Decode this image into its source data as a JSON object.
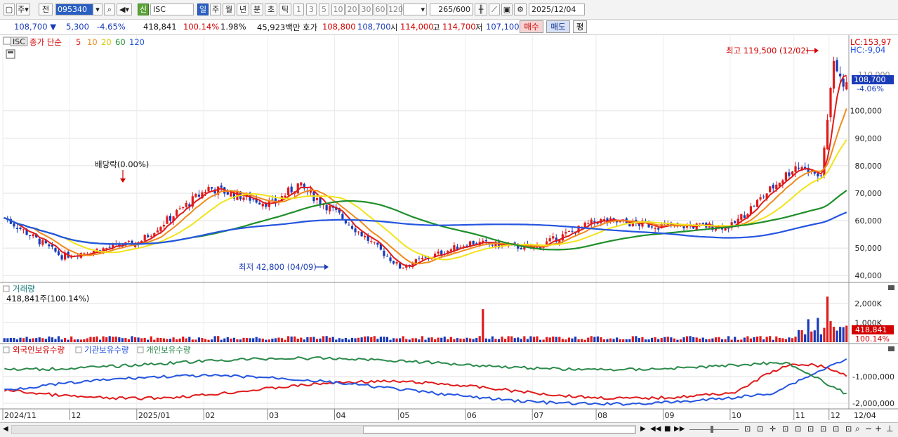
{
  "toolbar": {
    "period_select": "주",
    "prev_label": "전",
    "code": "095340",
    "new_badge": "신",
    "name": "ISC",
    "periods": [
      "일",
      "주",
      "월",
      "년",
      "분",
      "초",
      "틱"
    ],
    "intervals": [
      "1",
      "3",
      "5",
      "10",
      "20",
      "30",
      "60",
      "120"
    ],
    "count": "265",
    "count_total": "/600",
    "date": "2025/12/04"
  },
  "quote": {
    "price": "108,700",
    "change": "5,300",
    "change_pct": "-4.65%",
    "volume": "418,841",
    "volume_ratio": "100.14%",
    "turnover": "1.98%",
    "amount": "45,923백만",
    "hoga_label": "호가",
    "ask": "108,800",
    "bid": "108,700",
    "open_label": "시",
    "open": "114,000",
    "high_label": "고",
    "high": "114,700",
    "low_label": "저",
    "low": "107,100",
    "buy_label": "매수",
    "sell_label": "매도",
    "extra_label": "평"
  },
  "price_panel": {
    "symbol": "ISC",
    "legend_prefix": "종가 단순",
    "ma_labels": [
      "5",
      "10",
      "20",
      "60",
      "120"
    ],
    "ma_colors": [
      "#e01b1b",
      "#f08a1c",
      "#f2e31b",
      "#1f8f2a",
      "#2455e0"
    ],
    "lc": "LC:153,97",
    "hc": "HC:-9,04",
    "high_annot": "최고 119,500 (12/02)",
    "low_annot": "최저 42,800 (04/09)",
    "dividend_annot": "배당락(0.00%)",
    "price_tag": "108,700",
    "price_tag_pct": "-4.06%",
    "tag_hidden": "110,000",
    "y_ticks": [
      "40,000",
      "50,000",
      "60,000",
      "70,000",
      "80,000",
      "90,000",
      "100,000"
    ]
  },
  "volume_panel": {
    "title": "거래량",
    "value": "418,841주(100.14%)",
    "tag": "418,841",
    "tag_pct": "100.14%",
    "y_ticks": [
      "1,000K",
      "2,000K"
    ]
  },
  "holding_panel": {
    "legend": [
      "외국인보유수량",
      "기관보유수량",
      "개인보유수량"
    ],
    "colors": [
      "#e01b1b",
      "#2455e0",
      "#2a8a4a"
    ],
    "y_ticks": [
      "-1,000,000",
      "-2,000,000"
    ]
  },
  "x_axis": {
    "labels": [
      "2024/11",
      "12",
      "2025/01",
      "02",
      "03",
      "04",
      "05",
      "06",
      "07",
      "08",
      "09",
      "10",
      "11",
      "12",
      "12/04"
    ]
  },
  "chart_data": {
    "type": "candlestick",
    "ylim": [
      38000,
      125000
    ],
    "approx_close_path": [
      {
        "x": "2024/11",
        "y": 61000
      },
      {
        "x": "2024/11 mid",
        "y": 47000
      },
      {
        "x": "2024/12",
        "y": 52000
      },
      {
        "x": "2025/01",
        "y": 72000
      },
      {
        "x": "2025/02",
        "y": 66000
      },
      {
        "x": "2025/02 end",
        "y": 73000
      },
      {
        "x": "2025/03",
        "y": 62000
      },
      {
        "x": "2025/04",
        "y": 43000
      },
      {
        "x": "2025/05",
        "y": 52000
      },
      {
        "x": "2025/06",
        "y": 50000
      },
      {
        "x": "2025/07",
        "y": 60000
      },
      {
        "x": "2025/08",
        "y": 58000
      },
      {
        "x": "2025/09",
        "y": 58000
      },
      {
        "x": "2025/10",
        "y": 80000
      },
      {
        "x": "2025/11",
        "y": 76000
      },
      {
        "x": "2025/12/02",
        "y": 119500
      },
      {
        "x": "2025/12/04",
        "y": 108700
      }
    ],
    "highest": {
      "value": 119500,
      "date": "12/02"
    },
    "lowest": {
      "value": 42800,
      "date": "04/09"
    },
    "volume_ylim": [
      0,
      2500000
    ]
  }
}
